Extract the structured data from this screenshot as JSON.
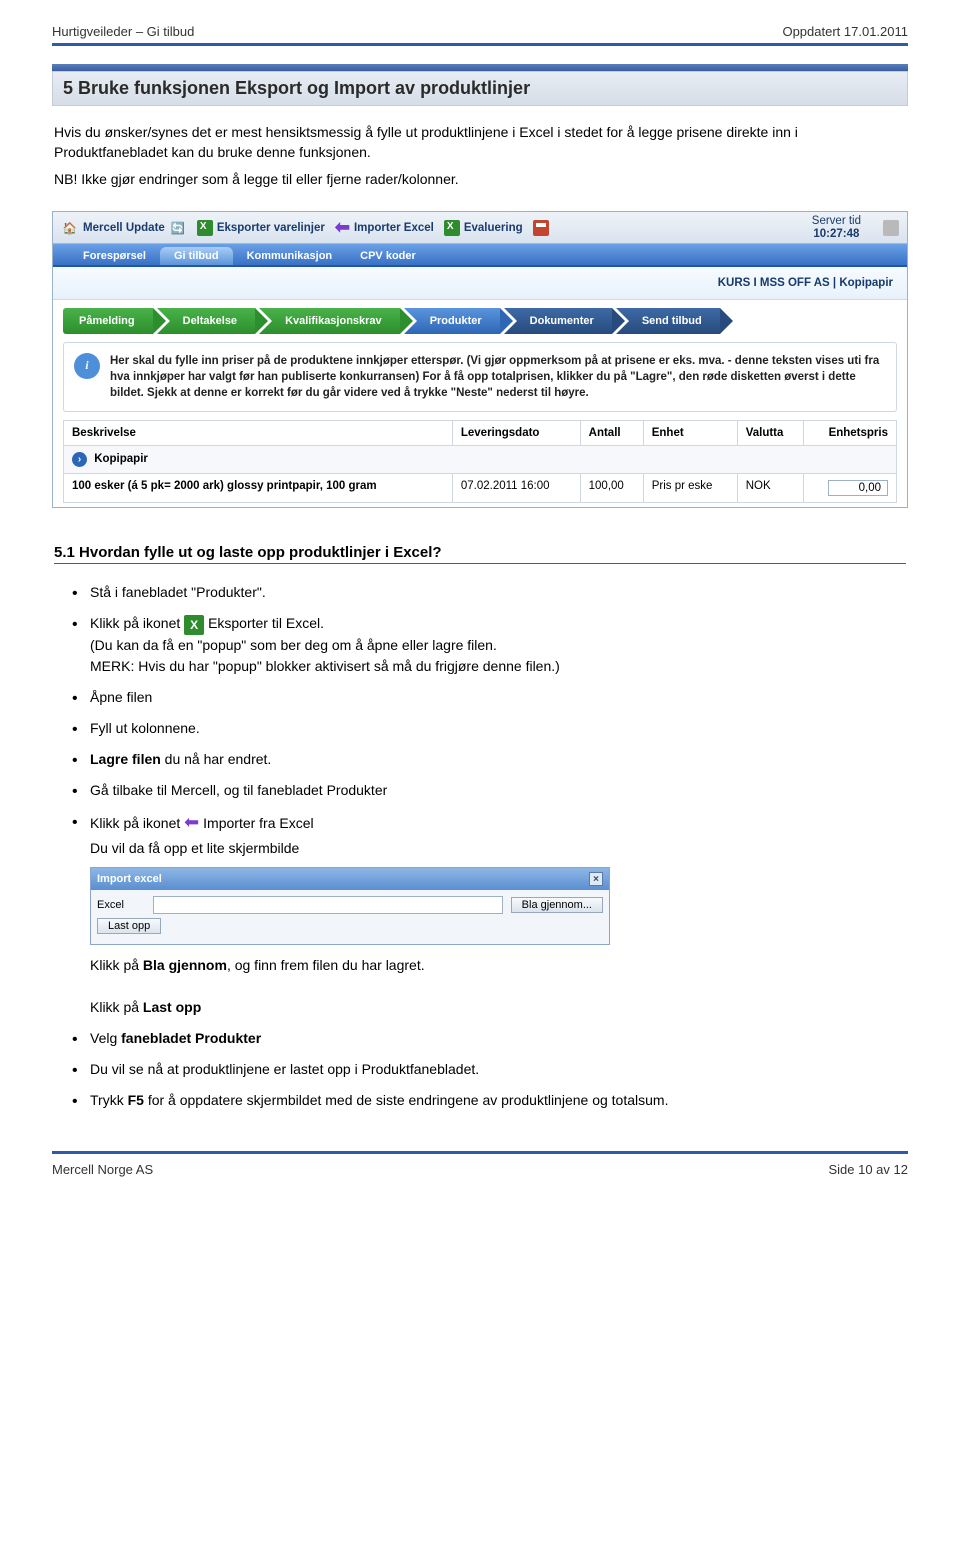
{
  "header": {
    "left": "Hurtigveileder – Gi tilbud",
    "right": "Oppdatert 17.01.2011"
  },
  "section5": {
    "title": "5 Bruke funksjonen Eksport og Import av produktlinjer",
    "para1": "Hvis du ønsker/synes det er mest hensiktsmessig å fylle ut produktlinjene i Excel i stedet for å legge prisene direkte inn i Produktfanebladet kan du bruke denne funksjonen.",
    "para2": "NB! Ikke gjør endringer som å legge til eller fjerne rader/kolonner."
  },
  "ss1": {
    "toolbar": {
      "update": "Mercell Update",
      "export": "Eksporter varelinjer",
      "import": "Importer Excel",
      "eval": "Evaluering",
      "server_tid_label": "Server tid",
      "server_tid_value": "10:27:48"
    },
    "tabs": [
      "Forespørsel",
      "Gi tilbud",
      "Kommunikasjon",
      "CPV koder"
    ],
    "active_tab": 1,
    "kurs": "KURS I MSS OFF AS | Kopipapir",
    "steps": [
      "Påmelding",
      "Deltakelse",
      "Kvalifikasjonskrav",
      "Produkter",
      "Dokumenter",
      "Send tilbud"
    ],
    "info": "Her skal du fylle inn priser på de produktene innkjøper etterspør. (Vi gjør oppmerksom på at prisene er eks. mva. - denne teksten vises uti fra hva innkjøper har valgt før han publiserte konkurransen) For å få opp totalprisen, klikker du på \"Lagre\", den røde disketten øverst i dette bildet. Sjekk at denne er korrekt før du går videre ved å trykke \"Neste\" nederst til høyre.",
    "table": {
      "headers": [
        "Beskrivelse",
        "Leveringsdato",
        "Antall",
        "Enhet",
        "Valutta",
        "Enhetspris"
      ],
      "group": "Kopipapir",
      "row": {
        "beskrivelse": "100 esker (á 5 pk= 2000 ark) glossy printpapir, 100 gram",
        "leveringsdato": "07.02.2011 16:00",
        "antall": "100,00",
        "enhet": "Pris pr eske",
        "valutta": "NOK",
        "enhetspris": "0,00"
      }
    }
  },
  "section51": {
    "title": "5.1 Hvordan fylle ut og laste opp produktlinjer i Excel?",
    "b1": "Stå i fanebladet \"Produkter\".",
    "b2a": "Klikk på ikonet",
    "b2b": "Eksporter til Excel.",
    "b2c": "(Du kan da få en \"popup\" som ber deg om å åpne eller lagre filen.",
    "b2d": "MERK: Hvis du har \"popup\" blokker aktivisert så må du frigjøre denne filen.)",
    "b3": "Åpne filen",
    "b4": "Fyll ut kolonnene.",
    "b5a": "Lagre filen",
    "b5b": " du nå har endret.",
    "b6": "Gå tilbake til Mercell, og til fanebladet Produkter",
    "b7a": "Klikk på ikonet",
    "b7b": "Importer fra Excel",
    "b7c": "Du vil da få opp et lite skjermbilde",
    "dlg": {
      "title": "Import excel",
      "label": "Excel",
      "browse": "Bla gjennom...",
      "upload": "Last opp"
    },
    "b8a": "Klikk på ",
    "b8b": "Bla gjennom",
    "b8c": ", og finn frem filen du har lagret.",
    "b9a": "Klikk på ",
    "b9b": "Last opp",
    "b10a": "Velg ",
    "b10b": "fanebladet Produkter",
    "b11": "Du vil se nå at produktlinjene er lastet opp i Produktfanebladet.",
    "b12a": "Trykk ",
    "b12b": "F5",
    "b12c": " for å oppdatere skjermbildet med de siste endringene av produktlinjene og totalsum."
  },
  "footer": {
    "left": "Mercell Norge AS",
    "right": "Side 10 av 12"
  }
}
